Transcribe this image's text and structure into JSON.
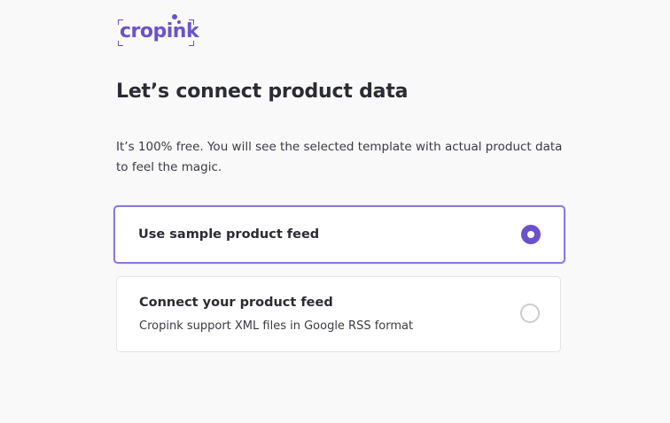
{
  "brand": {
    "logo_text": "cropink",
    "color": "#6b52cc"
  },
  "page": {
    "title": "Let’s connect product data",
    "description": "It’s 100% free. You will see the selected template with actual product data to feel the magic."
  },
  "options": [
    {
      "title": "Use sample product feed",
      "selected": true
    },
    {
      "title": "Connect your product feed",
      "subtitle": "Cropink support XML files in Google RSS format",
      "selected": false
    }
  ],
  "colors": {
    "accent": "#6b52cc",
    "selected_border": "#8c78dc",
    "card_border": "#e4e4e8",
    "background": "#f9f9fa"
  }
}
